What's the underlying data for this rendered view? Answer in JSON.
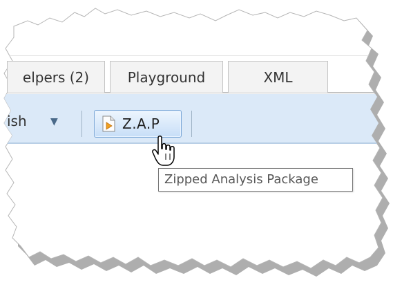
{
  "tabs": [
    {
      "label": "elpers (2)"
    },
    {
      "label": "Playground"
    },
    {
      "label": "XML"
    }
  ],
  "toolbar": {
    "publish_label": "ish",
    "zap_label": "Z.A.P"
  },
  "tooltip": {
    "text": "Zipped Analysis Package"
  },
  "icons": {
    "zap": "document-arrow-icon",
    "cursor": "hand-pointer-icon"
  },
  "colors": {
    "toolbar_bg": "#dbe9f8",
    "button_border": "#7aa6d6",
    "tooltip_border": "#767676"
  }
}
